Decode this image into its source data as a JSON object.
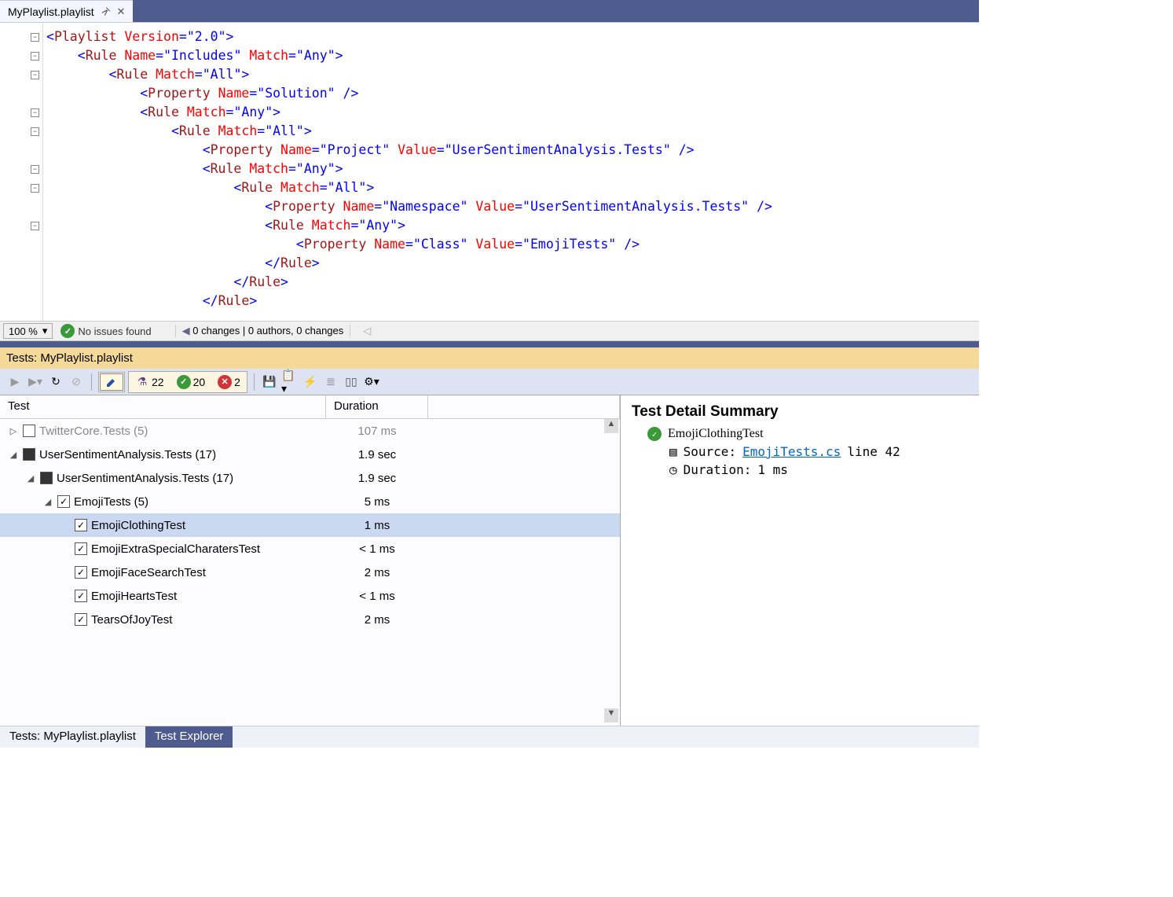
{
  "tab": {
    "name": "MyPlaylist.playlist"
  },
  "code": [
    {
      "indent": 0,
      "tokens": [
        {
          "t": "punct",
          "v": "<"
        },
        {
          "t": "tag",
          "v": "Playlist"
        },
        {
          "t": "plain",
          "v": " "
        },
        {
          "t": "attr",
          "v": "Version"
        },
        {
          "t": "punct",
          "v": "="
        },
        {
          "t": "val",
          "v": "\"2.0\""
        },
        {
          "t": "punct",
          "v": ">"
        }
      ]
    },
    {
      "indent": 2,
      "tokens": [
        {
          "t": "punct",
          "v": "<"
        },
        {
          "t": "tag",
          "v": "Rule"
        },
        {
          "t": "plain",
          "v": " "
        },
        {
          "t": "attr",
          "v": "Name"
        },
        {
          "t": "punct",
          "v": "="
        },
        {
          "t": "val",
          "v": "\"Includes\""
        },
        {
          "t": "plain",
          "v": " "
        },
        {
          "t": "attr",
          "v": "Match"
        },
        {
          "t": "punct",
          "v": "="
        },
        {
          "t": "val",
          "v": "\"Any\""
        },
        {
          "t": "punct",
          "v": ">"
        }
      ]
    },
    {
      "indent": 4,
      "tokens": [
        {
          "t": "punct",
          "v": "<"
        },
        {
          "t": "tag",
          "v": "Rule"
        },
        {
          "t": "plain",
          "v": " "
        },
        {
          "t": "attr",
          "v": "Match"
        },
        {
          "t": "punct",
          "v": "="
        },
        {
          "t": "val",
          "v": "\"All\""
        },
        {
          "t": "punct",
          "v": ">"
        }
      ]
    },
    {
      "indent": 6,
      "tokens": [
        {
          "t": "punct",
          "v": "<"
        },
        {
          "t": "tag",
          "v": "Property"
        },
        {
          "t": "plain",
          "v": " "
        },
        {
          "t": "attr",
          "v": "Name"
        },
        {
          "t": "punct",
          "v": "="
        },
        {
          "t": "val",
          "v": "\"Solution\""
        },
        {
          "t": "plain",
          "v": " "
        },
        {
          "t": "punct",
          "v": "/>"
        }
      ]
    },
    {
      "indent": 6,
      "tokens": [
        {
          "t": "punct",
          "v": "<"
        },
        {
          "t": "tag",
          "v": "Rule"
        },
        {
          "t": "plain",
          "v": " "
        },
        {
          "t": "attr",
          "v": "Match"
        },
        {
          "t": "punct",
          "v": "="
        },
        {
          "t": "val",
          "v": "\"Any\""
        },
        {
          "t": "punct",
          "v": ">"
        }
      ]
    },
    {
      "indent": 8,
      "tokens": [
        {
          "t": "punct",
          "v": "<"
        },
        {
          "t": "tag",
          "v": "Rule"
        },
        {
          "t": "plain",
          "v": " "
        },
        {
          "t": "attr",
          "v": "Match"
        },
        {
          "t": "punct",
          "v": "="
        },
        {
          "t": "val",
          "v": "\"All\""
        },
        {
          "t": "punct",
          "v": ">"
        }
      ]
    },
    {
      "indent": 10,
      "tokens": [
        {
          "t": "punct",
          "v": "<"
        },
        {
          "t": "tag",
          "v": "Property"
        },
        {
          "t": "plain",
          "v": " "
        },
        {
          "t": "attr",
          "v": "Name"
        },
        {
          "t": "punct",
          "v": "="
        },
        {
          "t": "val",
          "v": "\"Project\""
        },
        {
          "t": "plain",
          "v": " "
        },
        {
          "t": "attr",
          "v": "Value"
        },
        {
          "t": "punct",
          "v": "="
        },
        {
          "t": "val",
          "v": "\"UserSentimentAnalysis.Tests\""
        },
        {
          "t": "plain",
          "v": " "
        },
        {
          "t": "punct",
          "v": "/>"
        }
      ]
    },
    {
      "indent": 10,
      "tokens": [
        {
          "t": "punct",
          "v": "<"
        },
        {
          "t": "tag",
          "v": "Rule"
        },
        {
          "t": "plain",
          "v": " "
        },
        {
          "t": "attr",
          "v": "Match"
        },
        {
          "t": "punct",
          "v": "="
        },
        {
          "t": "val",
          "v": "\"Any\""
        },
        {
          "t": "punct",
          "v": ">"
        }
      ]
    },
    {
      "indent": 12,
      "tokens": [
        {
          "t": "punct",
          "v": "<"
        },
        {
          "t": "tag",
          "v": "Rule"
        },
        {
          "t": "plain",
          "v": " "
        },
        {
          "t": "attr",
          "v": "Match"
        },
        {
          "t": "punct",
          "v": "="
        },
        {
          "t": "val",
          "v": "\"All\""
        },
        {
          "t": "punct",
          "v": ">"
        }
      ]
    },
    {
      "indent": 14,
      "tokens": [
        {
          "t": "punct",
          "v": "<"
        },
        {
          "t": "tag",
          "v": "Property"
        },
        {
          "t": "plain",
          "v": " "
        },
        {
          "t": "attr",
          "v": "Name"
        },
        {
          "t": "punct",
          "v": "="
        },
        {
          "t": "val",
          "v": "\"Namespace\""
        },
        {
          "t": "plain",
          "v": " "
        },
        {
          "t": "attr",
          "v": "Value"
        },
        {
          "t": "punct",
          "v": "="
        },
        {
          "t": "val",
          "v": "\"UserSentimentAnalysis.Tests\""
        },
        {
          "t": "plain",
          "v": " "
        },
        {
          "t": "punct",
          "v": "/>"
        }
      ]
    },
    {
      "indent": 14,
      "tokens": [
        {
          "t": "punct",
          "v": "<"
        },
        {
          "t": "tag",
          "v": "Rule"
        },
        {
          "t": "plain",
          "v": " "
        },
        {
          "t": "attr",
          "v": "Match"
        },
        {
          "t": "punct",
          "v": "="
        },
        {
          "t": "val",
          "v": "\"Any\""
        },
        {
          "t": "punct",
          "v": ">"
        }
      ]
    },
    {
      "indent": 16,
      "tokens": [
        {
          "t": "punct",
          "v": "<"
        },
        {
          "t": "tag",
          "v": "Property"
        },
        {
          "t": "plain",
          "v": " "
        },
        {
          "t": "attr",
          "v": "Name"
        },
        {
          "t": "punct",
          "v": "="
        },
        {
          "t": "val",
          "v": "\"Class\""
        },
        {
          "t": "plain",
          "v": " "
        },
        {
          "t": "attr",
          "v": "Value"
        },
        {
          "t": "punct",
          "v": "="
        },
        {
          "t": "val",
          "v": "\"EmojiTests\""
        },
        {
          "t": "plain",
          "v": " "
        },
        {
          "t": "punct",
          "v": "/>"
        }
      ]
    },
    {
      "indent": 14,
      "tokens": [
        {
          "t": "punct",
          "v": "</"
        },
        {
          "t": "tag",
          "v": "Rule"
        },
        {
          "t": "punct",
          "v": ">"
        }
      ]
    },
    {
      "indent": 12,
      "tokens": [
        {
          "t": "punct",
          "v": "</"
        },
        {
          "t": "tag",
          "v": "Rule"
        },
        {
          "t": "punct",
          "v": ">"
        }
      ]
    },
    {
      "indent": 10,
      "tokens": [
        {
          "t": "punct",
          "v": "</"
        },
        {
          "t": "tag",
          "v": "Rule"
        },
        {
          "t": "punct",
          "v": ">"
        }
      ]
    }
  ],
  "status": {
    "zoom": "100 %",
    "issues": "No issues found",
    "changes": "0 changes | 0 authors, 0 changes"
  },
  "testHeader": "Tests: MyPlaylist.playlist",
  "toolbar": {
    "total": "22",
    "passed": "20",
    "failed": "2"
  },
  "columns": {
    "test": "Test",
    "duration": "Duration"
  },
  "tree": [
    {
      "indent": 0,
      "expander": "▷",
      "check": "empty",
      "label": "TwitterCore.Tests",
      "count": "(5)",
      "dur": "107 ms",
      "dim": true
    },
    {
      "indent": 0,
      "expander": "◢",
      "check": "filled",
      "label": "UserSentimentAnalysis.Tests",
      "count": "(17)",
      "dur": "1.9 sec"
    },
    {
      "indent": 1,
      "expander": "◢",
      "check": "filled",
      "label": "UserSentimentAnalysis.Tests",
      "count": "(17)",
      "dur": "1.9 sec"
    },
    {
      "indent": 2,
      "expander": "◢",
      "check": "check",
      "label": "EmojiTests",
      "count": "(5)",
      "dur": "5 ms"
    },
    {
      "indent": 3,
      "expander": "",
      "check": "check",
      "label": "EmojiClothingTest",
      "count": "",
      "dur": "1 ms",
      "selected": true
    },
    {
      "indent": 3,
      "expander": "",
      "check": "check",
      "label": "EmojiExtraSpecialCharatersTest",
      "count": "",
      "dur": "< 1 ms"
    },
    {
      "indent": 3,
      "expander": "",
      "check": "check",
      "label": "EmojiFaceSearchTest",
      "count": "",
      "dur": "2 ms"
    },
    {
      "indent": 3,
      "expander": "",
      "check": "check",
      "label": "EmojiHeartsTest",
      "count": "",
      "dur": "< 1 ms"
    },
    {
      "indent": 3,
      "expander": "",
      "check": "check",
      "label": "TearsOfJoyTest",
      "count": "",
      "dur": "2 ms"
    }
  ],
  "detail": {
    "title": "Test Detail Summary",
    "name": "EmojiClothingTest",
    "sourceLabel": "Source:",
    "sourceFile": "EmojiTests.cs",
    "sourceLine": "line 42",
    "durationLabel": "Duration:",
    "durationValue": "1 ms"
  },
  "bottomTabs": {
    "tests": "Tests: MyPlaylist.playlist",
    "explorer": "Test Explorer"
  }
}
